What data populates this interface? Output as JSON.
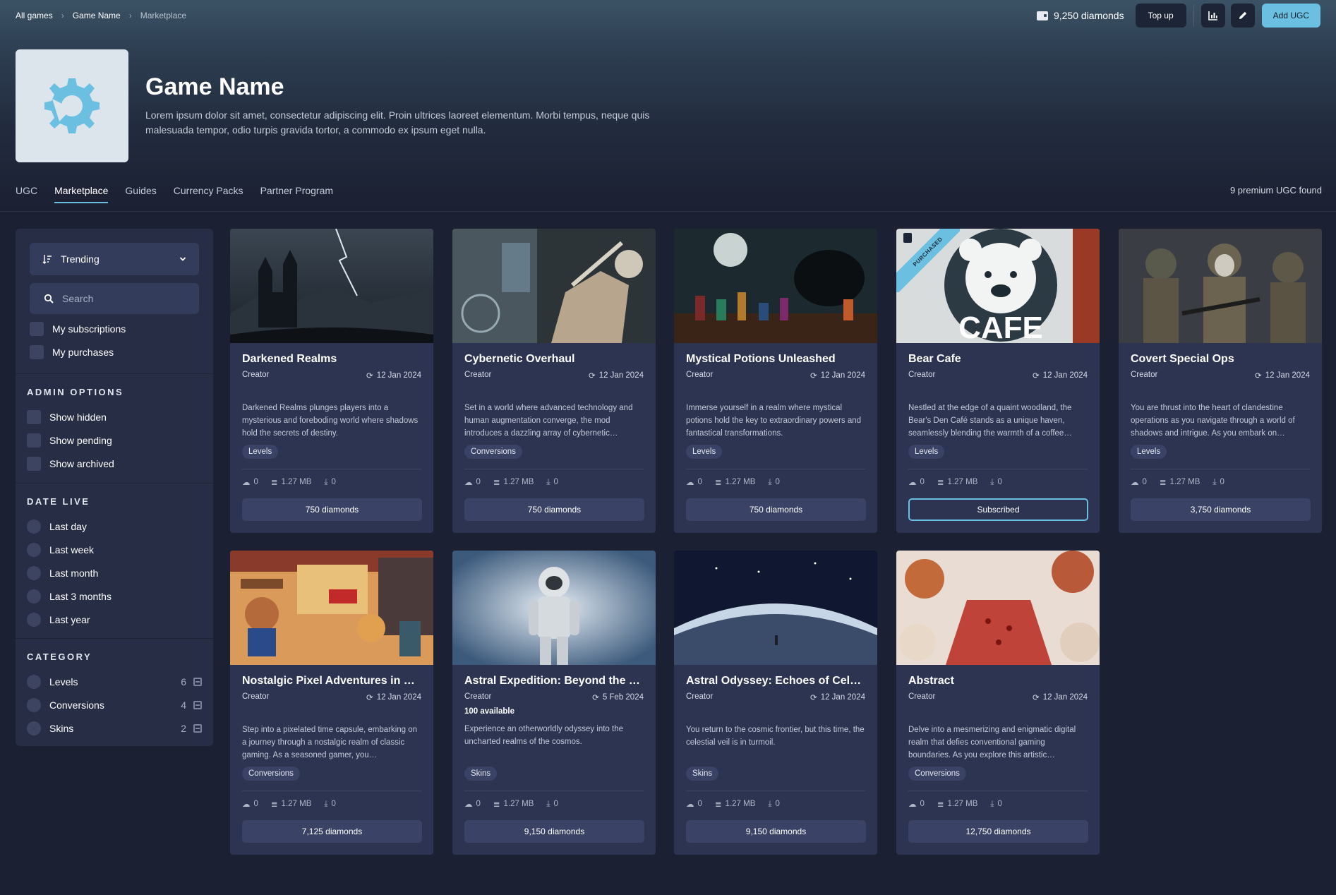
{
  "breadcrumb": [
    "All games",
    "Game Name",
    "Marketplace"
  ],
  "wallet": {
    "balance": "9,250 diamonds",
    "topup_label": "Top up",
    "add_label": "Add UGC"
  },
  "game": {
    "title": "Game Name",
    "description": "Lorem ipsum dolor sit amet, consectetur adipiscing elit. Proin ultrices laoreet elementum. Morbi tempus, neque quis malesuada tempor, odio turpis gravida tortor, a commodo ex ipsum eget nulla."
  },
  "tabs": [
    "UGC",
    "Marketplace",
    "Guides",
    "Currency Packs",
    "Partner Program"
  ],
  "active_tab": "Marketplace",
  "result_count": "9 premium UGC found",
  "sidebar": {
    "sort": "Trending",
    "search_placeholder": "Search",
    "filters": [
      "My subscriptions",
      "My purchases"
    ],
    "admin_title": "ADMIN OPTIONS",
    "admin_options": [
      "Show hidden",
      "Show pending",
      "Show archived"
    ],
    "date_title": "DATE LIVE",
    "date_options": [
      "Last day",
      "Last week",
      "Last month",
      "Last 3 months",
      "Last year"
    ],
    "category_title": "CATEGORY",
    "categories": [
      {
        "label": "Levels",
        "count": "6"
      },
      {
        "label": "Conversions",
        "count": "4"
      },
      {
        "label": "Skins",
        "count": "2"
      }
    ]
  },
  "colors": {
    "accent": "#6bbfe0",
    "card": "#2c3452",
    "background": "#1b2032"
  },
  "cards": [
    {
      "title": "Darkened Realms",
      "creator": "Creator",
      "date": "12 Jan 2024",
      "desc": "Darkened Realms plunges players into a mysterious and foreboding world where shadows hold the secrets of destiny.",
      "tag": "Levels",
      "likes": "0",
      "size": "1.27 MB",
      "downloads": "0",
      "button": "750 diamonds"
    },
    {
      "title": "Cybernetic Overhaul",
      "creator": "Creator",
      "date": "12 Jan 2024",
      "desc": "Set in a world where advanced technology and human augmentation converge, the mod introduces a dazzling array of cybernetic…",
      "tag": "Conversions",
      "likes": "0",
      "size": "1.27 MB",
      "downloads": "0",
      "button": "750 diamonds"
    },
    {
      "title": "Mystical Potions Unleashed",
      "creator": "Creator",
      "date": "12 Jan 2024",
      "desc": "Immerse yourself in a realm where mystical potions hold the key to extraordinary powers and fantastical transformations.",
      "tag": "Levels",
      "likes": "0",
      "size": "1.27 MB",
      "downloads": "0",
      "button": "750 diamonds"
    },
    {
      "title": "Bear Cafe",
      "creator": "Creator",
      "date": "12 Jan 2024",
      "desc": "Nestled at the edge of a quaint woodland, the Bear's Den Café stands as a unique haven, seamlessly blending the warmth of a coffee…",
      "tag": "Levels",
      "likes": "0",
      "size": "1.27 MB",
      "downloads": "0",
      "button": "Subscribed",
      "badge": "PURCHASED",
      "image_text": "CAFE"
    },
    {
      "title": "Covert Special Ops",
      "creator": "Creator",
      "date": "12 Jan 2024",
      "desc": "You are thrust into the heart of clandestine operations as you navigate through a world of shadows and intrigue. As you embark on…",
      "tag": "Levels",
      "likes": "0",
      "size": "1.27 MB",
      "downloads": "0",
      "button": "3,750 diamonds"
    },
    {
      "title": "Nostalgic Pixel Adventures in …",
      "creator": "Creator",
      "date": "12 Jan 2024",
      "desc": "Step into a pixelated time capsule, embarking on a journey through a nostalgic realm of classic gaming. As a seasoned gamer, you…",
      "tag": "Conversions",
      "likes": "0",
      "size": "1.27 MB",
      "downloads": "0",
      "button": "7,125 diamonds"
    },
    {
      "title": "Astral Expedition: Beyond the …",
      "creator": "Creator",
      "date": "5 Feb 2024",
      "availability": "100 available",
      "desc": "Experience an otherworldly odyssey into the uncharted realms of the cosmos.",
      "tag": "Skins",
      "likes": "0",
      "size": "1.27 MB",
      "downloads": "0",
      "button": "9,150 diamonds"
    },
    {
      "title": "Astral Odyssey: Echoes of Cel…",
      "creator": "Creator",
      "date": "12 Jan 2024",
      "desc": "You return to the cosmic frontier, but this time, the celestial veil is in turmoil.",
      "tag": "Skins",
      "likes": "0",
      "size": "1.27 MB",
      "downloads": "0",
      "button": "9,150 diamonds"
    },
    {
      "title": "Abstract",
      "creator": "Creator",
      "date": "12 Jan 2024",
      "desc": "Delve into a mesmerizing and enigmatic digital realm that defies conventional gaming boundaries. As you explore this artistic…",
      "tag": "Conversions",
      "likes": "0",
      "size": "1.27 MB",
      "downloads": "0",
      "button": "12,750 diamonds"
    }
  ]
}
